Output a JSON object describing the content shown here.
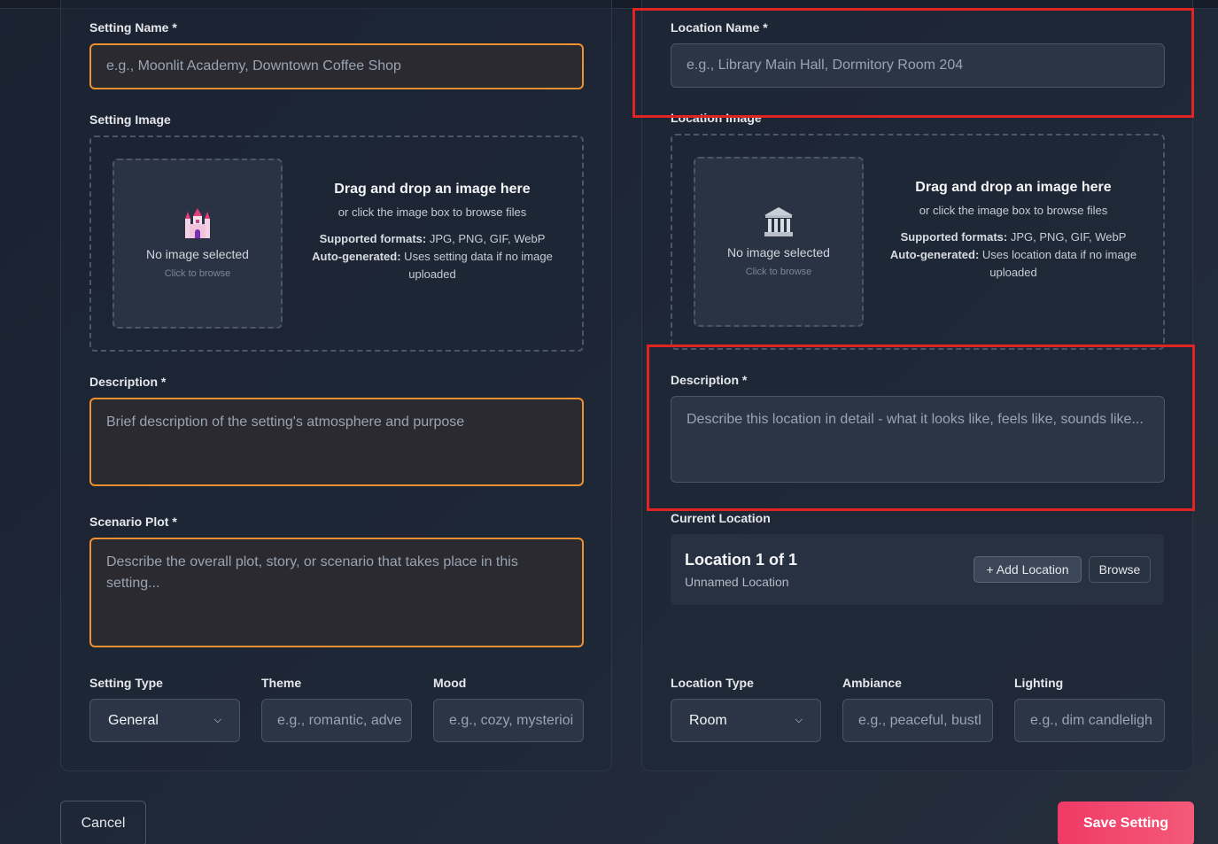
{
  "left": {
    "name_label": "Setting Name *",
    "name_placeholder": "e.g., Moonlit Academy, Downtown Coffee Shop",
    "image_label": "Setting Image",
    "no_image": "No image selected",
    "click_browse": "Click to browse",
    "drag_title": "Drag and drop an image here",
    "drag_sub": "or click the image box to browse files",
    "formats_key": "Supported formats:",
    "formats_val": " JPG, PNG, GIF, WebP",
    "auto_key": "Auto-generated:",
    "auto_val": " Uses setting data if no image uploaded",
    "desc_label": "Description *",
    "desc_placeholder": "Brief description of the setting's atmosphere and purpose",
    "plot_label": "Scenario Plot *",
    "plot_placeholder": "Describe the overall plot, story, or scenario that takes place in this setting...",
    "type_label": "Setting Type",
    "type_value": "General",
    "theme_label": "Theme",
    "theme_placeholder": "e.g., romantic, adve",
    "mood_label": "Mood",
    "mood_placeholder": "e.g., cozy, mysterioi",
    "icon": "castle-icon"
  },
  "right": {
    "name_label": "Location Name *",
    "name_placeholder": "e.g., Library Main Hall, Dormitory Room 204",
    "image_label": "Location Image",
    "no_image": "No image selected",
    "click_browse": "Click to browse",
    "drag_title": "Drag and drop an image here",
    "drag_sub": "or click the image box to browse files",
    "formats_key": "Supported formats:",
    "formats_val": " JPG, PNG, GIF, WebP",
    "auto_key": "Auto-generated:",
    "auto_val": " Uses location data if no image uploaded",
    "desc_label": "Description *",
    "desc_placeholder": "Describe this location in detail - what it looks like, feels like, sounds like...",
    "current_label": "Current Location",
    "loc_title": "Location 1 of 1",
    "loc_sub": "Unnamed Location",
    "add_btn": "+ Add Location",
    "browse_btn": "Browse",
    "type_label": "Location Type",
    "type_value": "Room",
    "ambiance_label": "Ambiance",
    "ambiance_placeholder": "e.g., peaceful, bustl",
    "lighting_label": "Lighting",
    "lighting_placeholder": "e.g., dim candleligh",
    "icon": "museum-icon"
  },
  "footer": {
    "cancel": "Cancel",
    "save": "Save Setting"
  },
  "colors": {
    "accent_orange": "#f0902e",
    "save_pink": "#ef3a66",
    "highlight_red": "#e02424"
  }
}
